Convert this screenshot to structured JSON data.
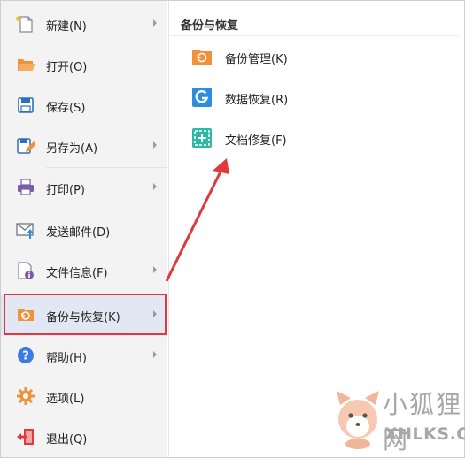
{
  "menu": {
    "items": [
      {
        "label": "新建(N)",
        "icon": "new-doc-icon",
        "submenu": true
      },
      {
        "label": "打开(O)",
        "icon": "open-folder-icon",
        "submenu": false
      },
      {
        "label": "保存(S)",
        "icon": "save-icon",
        "submenu": false
      },
      {
        "label": "另存为(A)",
        "icon": "save-as-icon",
        "submenu": true
      },
      {
        "label": "打印(P)",
        "icon": "print-icon",
        "submenu": true
      },
      {
        "label": "发送邮件(D)",
        "icon": "mail-icon",
        "submenu": false
      },
      {
        "label": "文件信息(F)",
        "icon": "file-info-icon",
        "submenu": true
      },
      {
        "label": "备份与恢复(K)",
        "icon": "backup-icon",
        "submenu": true
      },
      {
        "label": "帮助(H)",
        "icon": "help-icon",
        "submenu": true
      },
      {
        "label": "选项(L)",
        "icon": "gear-icon",
        "submenu": false
      },
      {
        "label": "退出(Q)",
        "icon": "exit-icon",
        "submenu": false
      }
    ],
    "active_label": "备份与恢复(K)"
  },
  "submenu": {
    "title": "备份与恢复",
    "items": [
      {
        "label": "备份管理(K)",
        "icon": "backup-manage-icon"
      },
      {
        "label": "数据恢复(R)",
        "icon": "data-recovery-icon"
      },
      {
        "label": "文档修复(F)",
        "icon": "doc-repair-icon"
      }
    ]
  },
  "watermark": {
    "text_cn": "小狐狸网",
    "text_en": "XHLKS.CN"
  },
  "colors": {
    "highlight": "#e0393b",
    "active_bg": "#e2e8f3",
    "menu_bg": "#f3f3f3",
    "orange": "#f0913b",
    "blue": "#2c8ee0",
    "teal": "#2fb7a7"
  }
}
